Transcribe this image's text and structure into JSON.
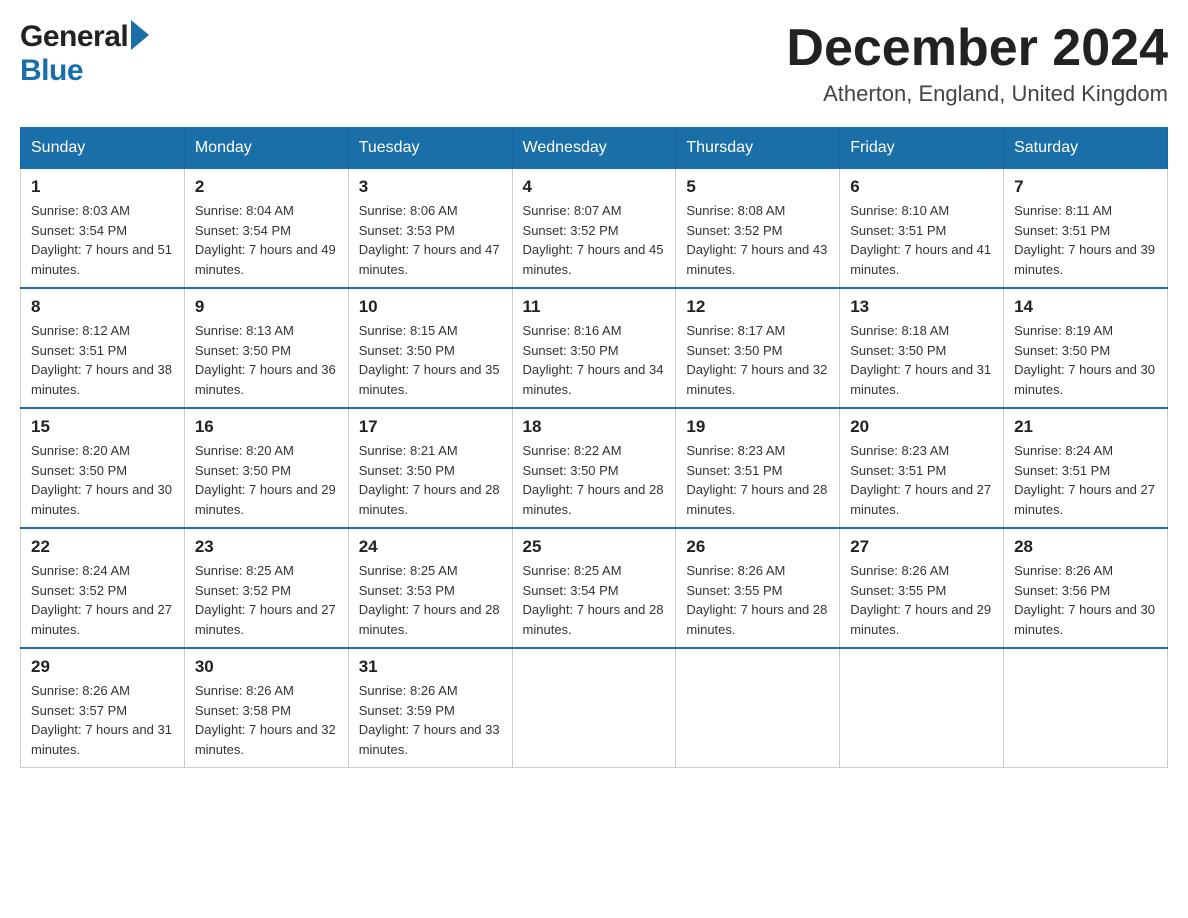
{
  "header": {
    "month_title": "December 2024",
    "location": "Atherton, England, United Kingdom",
    "logo_general": "General",
    "logo_blue": "Blue"
  },
  "days_of_week": [
    "Sunday",
    "Monday",
    "Tuesday",
    "Wednesday",
    "Thursday",
    "Friday",
    "Saturday"
  ],
  "weeks": [
    [
      {
        "day": "1",
        "sunrise": "8:03 AM",
        "sunset": "3:54 PM",
        "daylight": "7 hours and 51 minutes."
      },
      {
        "day": "2",
        "sunrise": "8:04 AM",
        "sunset": "3:54 PM",
        "daylight": "7 hours and 49 minutes."
      },
      {
        "day": "3",
        "sunrise": "8:06 AM",
        "sunset": "3:53 PM",
        "daylight": "7 hours and 47 minutes."
      },
      {
        "day": "4",
        "sunrise": "8:07 AM",
        "sunset": "3:52 PM",
        "daylight": "7 hours and 45 minutes."
      },
      {
        "day": "5",
        "sunrise": "8:08 AM",
        "sunset": "3:52 PM",
        "daylight": "7 hours and 43 minutes."
      },
      {
        "day": "6",
        "sunrise": "8:10 AM",
        "sunset": "3:51 PM",
        "daylight": "7 hours and 41 minutes."
      },
      {
        "day": "7",
        "sunrise": "8:11 AM",
        "sunset": "3:51 PM",
        "daylight": "7 hours and 39 minutes."
      }
    ],
    [
      {
        "day": "8",
        "sunrise": "8:12 AM",
        "sunset": "3:51 PM",
        "daylight": "7 hours and 38 minutes."
      },
      {
        "day": "9",
        "sunrise": "8:13 AM",
        "sunset": "3:50 PM",
        "daylight": "7 hours and 36 minutes."
      },
      {
        "day": "10",
        "sunrise": "8:15 AM",
        "sunset": "3:50 PM",
        "daylight": "7 hours and 35 minutes."
      },
      {
        "day": "11",
        "sunrise": "8:16 AM",
        "sunset": "3:50 PM",
        "daylight": "7 hours and 34 minutes."
      },
      {
        "day": "12",
        "sunrise": "8:17 AM",
        "sunset": "3:50 PM",
        "daylight": "7 hours and 32 minutes."
      },
      {
        "day": "13",
        "sunrise": "8:18 AM",
        "sunset": "3:50 PM",
        "daylight": "7 hours and 31 minutes."
      },
      {
        "day": "14",
        "sunrise": "8:19 AM",
        "sunset": "3:50 PM",
        "daylight": "7 hours and 30 minutes."
      }
    ],
    [
      {
        "day": "15",
        "sunrise": "8:20 AM",
        "sunset": "3:50 PM",
        "daylight": "7 hours and 30 minutes."
      },
      {
        "day": "16",
        "sunrise": "8:20 AM",
        "sunset": "3:50 PM",
        "daylight": "7 hours and 29 minutes."
      },
      {
        "day": "17",
        "sunrise": "8:21 AM",
        "sunset": "3:50 PM",
        "daylight": "7 hours and 28 minutes."
      },
      {
        "day": "18",
        "sunrise": "8:22 AM",
        "sunset": "3:50 PM",
        "daylight": "7 hours and 28 minutes."
      },
      {
        "day": "19",
        "sunrise": "8:23 AM",
        "sunset": "3:51 PM",
        "daylight": "7 hours and 28 minutes."
      },
      {
        "day": "20",
        "sunrise": "8:23 AM",
        "sunset": "3:51 PM",
        "daylight": "7 hours and 27 minutes."
      },
      {
        "day": "21",
        "sunrise": "8:24 AM",
        "sunset": "3:51 PM",
        "daylight": "7 hours and 27 minutes."
      }
    ],
    [
      {
        "day": "22",
        "sunrise": "8:24 AM",
        "sunset": "3:52 PM",
        "daylight": "7 hours and 27 minutes."
      },
      {
        "day": "23",
        "sunrise": "8:25 AM",
        "sunset": "3:52 PM",
        "daylight": "7 hours and 27 minutes."
      },
      {
        "day": "24",
        "sunrise": "8:25 AM",
        "sunset": "3:53 PM",
        "daylight": "7 hours and 28 minutes."
      },
      {
        "day": "25",
        "sunrise": "8:25 AM",
        "sunset": "3:54 PM",
        "daylight": "7 hours and 28 minutes."
      },
      {
        "day": "26",
        "sunrise": "8:26 AM",
        "sunset": "3:55 PM",
        "daylight": "7 hours and 28 minutes."
      },
      {
        "day": "27",
        "sunrise": "8:26 AM",
        "sunset": "3:55 PM",
        "daylight": "7 hours and 29 minutes."
      },
      {
        "day": "28",
        "sunrise": "8:26 AM",
        "sunset": "3:56 PM",
        "daylight": "7 hours and 30 minutes."
      }
    ],
    [
      {
        "day": "29",
        "sunrise": "8:26 AM",
        "sunset": "3:57 PM",
        "daylight": "7 hours and 31 minutes."
      },
      {
        "day": "30",
        "sunrise": "8:26 AM",
        "sunset": "3:58 PM",
        "daylight": "7 hours and 32 minutes."
      },
      {
        "day": "31",
        "sunrise": "8:26 AM",
        "sunset": "3:59 PM",
        "daylight": "7 hours and 33 minutes."
      },
      null,
      null,
      null,
      null
    ]
  ]
}
